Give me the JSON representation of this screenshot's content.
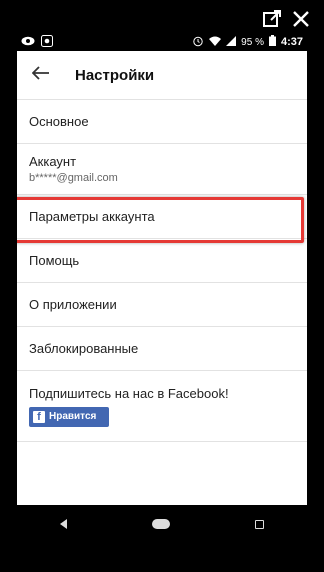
{
  "app": {
    "title": "Настройки"
  },
  "status_bar": {
    "battery_percent": "95 %",
    "time": "4:37"
  },
  "settings": {
    "items": [
      {
        "label": "Основное"
      },
      {
        "label": "Аккаунт",
        "subtext": "b*****@gmail.com"
      },
      {
        "label": "Параметры аккаунта"
      },
      {
        "label": "Помощь"
      },
      {
        "label": "О приложении"
      },
      {
        "label": "Заблокированные"
      }
    ],
    "facebook": {
      "text": "Подпишитесь на нас в Facebook!",
      "button_label": "Нравится",
      "logo_letter": "f"
    }
  },
  "icons": {
    "external": "external-link-icon",
    "close": "close-icon",
    "back": "arrow-left-icon",
    "eye": "eye-icon",
    "battery": "battery-icon",
    "wifi": "wifi-icon"
  },
  "colors": {
    "highlight": "#e53935",
    "facebook": "#4267b2"
  }
}
